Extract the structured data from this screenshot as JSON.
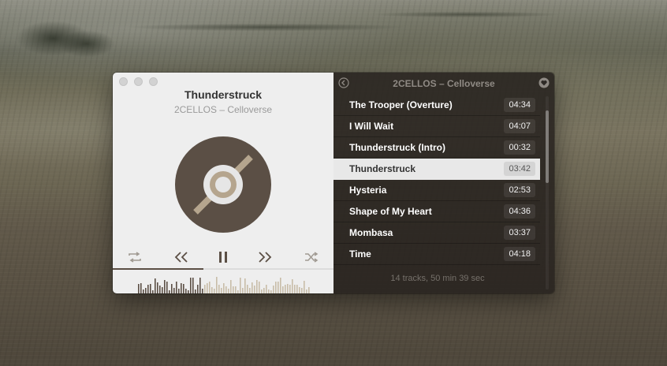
{
  "player": {
    "window_controls": [
      "close",
      "minimize",
      "zoom"
    ],
    "now_playing": {
      "title": "Thunderstruck",
      "artist_album": "2CELLOS – Celloverse"
    },
    "controls": {
      "repeat_icon": "repeat-icon",
      "previous_icon": "previous-icon",
      "play_pause_icon": "pause-icon",
      "next_icon": "next-icon",
      "shuffle_icon": "shuffle-icon"
    },
    "progress_fraction": 0.41,
    "accent_color": "#5b4f45",
    "disc_accent_color": "#b5a58e"
  },
  "playlist": {
    "album_title": "2CELLOS – Celloverse",
    "back_icon": "chevron-left-icon",
    "favorite_icon": "heart-icon",
    "tracks": [
      {
        "title": "The Trooper (Overture)",
        "duration": "04:34"
      },
      {
        "title": "I Will Wait",
        "duration": "04:07"
      },
      {
        "title": "Thunderstruck (Intro)",
        "duration": "00:32"
      },
      {
        "title": "Thunderstruck",
        "duration": "03:42"
      },
      {
        "title": "Hysteria",
        "duration": "02:53"
      },
      {
        "title": "Shape of My Heart",
        "duration": "04:36"
      },
      {
        "title": "Mombasa",
        "duration": "03:37"
      },
      {
        "title": "Time",
        "duration": "04:18"
      }
    ],
    "active_index": 3,
    "summary": "14 tracks, 50 min 39 sec"
  }
}
